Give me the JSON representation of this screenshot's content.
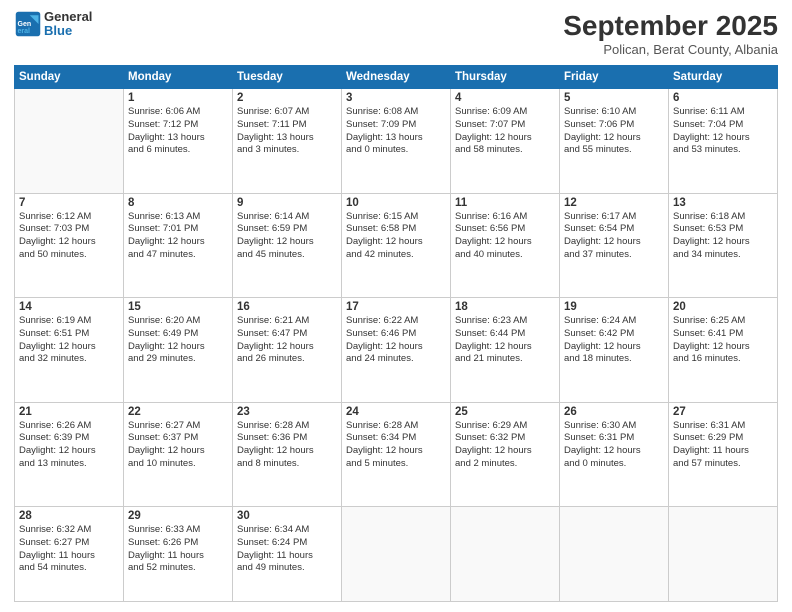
{
  "header": {
    "logo": {
      "general": "General",
      "blue": "Blue"
    },
    "title": "September 2025",
    "subtitle": "Polican, Berat County, Albania"
  },
  "days_of_week": [
    "Sunday",
    "Monday",
    "Tuesday",
    "Wednesday",
    "Thursday",
    "Friday",
    "Saturday"
  ],
  "weeks": [
    [
      {
        "day": "",
        "info": ""
      },
      {
        "day": "1",
        "info": "Sunrise: 6:06 AM\nSunset: 7:12 PM\nDaylight: 13 hours\nand 6 minutes."
      },
      {
        "day": "2",
        "info": "Sunrise: 6:07 AM\nSunset: 7:11 PM\nDaylight: 13 hours\nand 3 minutes."
      },
      {
        "day": "3",
        "info": "Sunrise: 6:08 AM\nSunset: 7:09 PM\nDaylight: 13 hours\nand 0 minutes."
      },
      {
        "day": "4",
        "info": "Sunrise: 6:09 AM\nSunset: 7:07 PM\nDaylight: 12 hours\nand 58 minutes."
      },
      {
        "day": "5",
        "info": "Sunrise: 6:10 AM\nSunset: 7:06 PM\nDaylight: 12 hours\nand 55 minutes."
      },
      {
        "day": "6",
        "info": "Sunrise: 6:11 AM\nSunset: 7:04 PM\nDaylight: 12 hours\nand 53 minutes."
      }
    ],
    [
      {
        "day": "7",
        "info": "Sunrise: 6:12 AM\nSunset: 7:03 PM\nDaylight: 12 hours\nand 50 minutes."
      },
      {
        "day": "8",
        "info": "Sunrise: 6:13 AM\nSunset: 7:01 PM\nDaylight: 12 hours\nand 47 minutes."
      },
      {
        "day": "9",
        "info": "Sunrise: 6:14 AM\nSunset: 6:59 PM\nDaylight: 12 hours\nand 45 minutes."
      },
      {
        "day": "10",
        "info": "Sunrise: 6:15 AM\nSunset: 6:58 PM\nDaylight: 12 hours\nand 42 minutes."
      },
      {
        "day": "11",
        "info": "Sunrise: 6:16 AM\nSunset: 6:56 PM\nDaylight: 12 hours\nand 40 minutes."
      },
      {
        "day": "12",
        "info": "Sunrise: 6:17 AM\nSunset: 6:54 PM\nDaylight: 12 hours\nand 37 minutes."
      },
      {
        "day": "13",
        "info": "Sunrise: 6:18 AM\nSunset: 6:53 PM\nDaylight: 12 hours\nand 34 minutes."
      }
    ],
    [
      {
        "day": "14",
        "info": "Sunrise: 6:19 AM\nSunset: 6:51 PM\nDaylight: 12 hours\nand 32 minutes."
      },
      {
        "day": "15",
        "info": "Sunrise: 6:20 AM\nSunset: 6:49 PM\nDaylight: 12 hours\nand 29 minutes."
      },
      {
        "day": "16",
        "info": "Sunrise: 6:21 AM\nSunset: 6:47 PM\nDaylight: 12 hours\nand 26 minutes."
      },
      {
        "day": "17",
        "info": "Sunrise: 6:22 AM\nSunset: 6:46 PM\nDaylight: 12 hours\nand 24 minutes."
      },
      {
        "day": "18",
        "info": "Sunrise: 6:23 AM\nSunset: 6:44 PM\nDaylight: 12 hours\nand 21 minutes."
      },
      {
        "day": "19",
        "info": "Sunrise: 6:24 AM\nSunset: 6:42 PM\nDaylight: 12 hours\nand 18 minutes."
      },
      {
        "day": "20",
        "info": "Sunrise: 6:25 AM\nSunset: 6:41 PM\nDaylight: 12 hours\nand 16 minutes."
      }
    ],
    [
      {
        "day": "21",
        "info": "Sunrise: 6:26 AM\nSunset: 6:39 PM\nDaylight: 12 hours\nand 13 minutes."
      },
      {
        "day": "22",
        "info": "Sunrise: 6:27 AM\nSunset: 6:37 PM\nDaylight: 12 hours\nand 10 minutes."
      },
      {
        "day": "23",
        "info": "Sunrise: 6:28 AM\nSunset: 6:36 PM\nDaylight: 12 hours\nand 8 minutes."
      },
      {
        "day": "24",
        "info": "Sunrise: 6:28 AM\nSunset: 6:34 PM\nDaylight: 12 hours\nand 5 minutes."
      },
      {
        "day": "25",
        "info": "Sunrise: 6:29 AM\nSunset: 6:32 PM\nDaylight: 12 hours\nand 2 minutes."
      },
      {
        "day": "26",
        "info": "Sunrise: 6:30 AM\nSunset: 6:31 PM\nDaylight: 12 hours\nand 0 minutes."
      },
      {
        "day": "27",
        "info": "Sunrise: 6:31 AM\nSunset: 6:29 PM\nDaylight: 11 hours\nand 57 minutes."
      }
    ],
    [
      {
        "day": "28",
        "info": "Sunrise: 6:32 AM\nSunset: 6:27 PM\nDaylight: 11 hours\nand 54 minutes."
      },
      {
        "day": "29",
        "info": "Sunrise: 6:33 AM\nSunset: 6:26 PM\nDaylight: 11 hours\nand 52 minutes."
      },
      {
        "day": "30",
        "info": "Sunrise: 6:34 AM\nSunset: 6:24 PM\nDaylight: 11 hours\nand 49 minutes."
      },
      {
        "day": "",
        "info": ""
      },
      {
        "day": "",
        "info": ""
      },
      {
        "day": "",
        "info": ""
      },
      {
        "day": "",
        "info": ""
      }
    ]
  ]
}
